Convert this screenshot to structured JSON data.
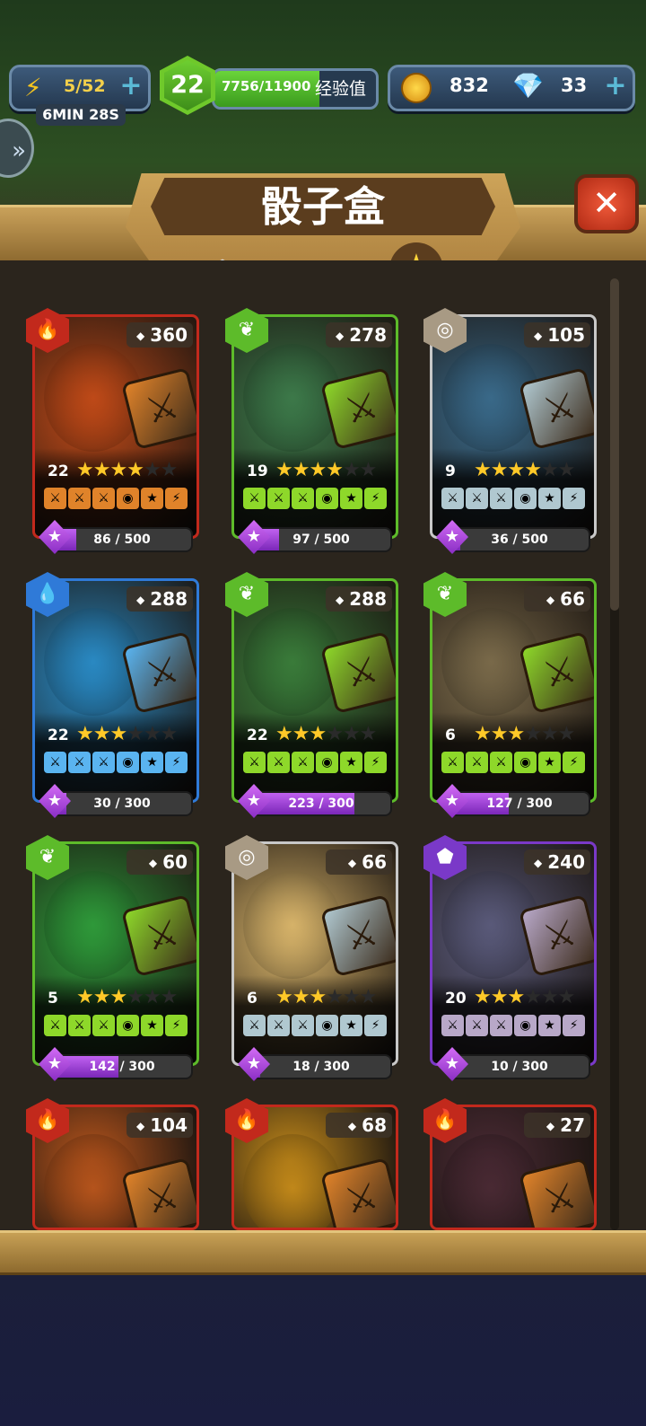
{
  "header": {
    "energy": "5/52",
    "energy_timer": "6MIN 28S",
    "level": "22",
    "xp_text": "7756/11900",
    "xp_label": "经验值",
    "xp_fraction": 0.652,
    "gold": "832",
    "gems": "33"
  },
  "title": "骰子盒",
  "tabs": [
    "hex-cluster",
    "diamond",
    "star"
  ],
  "active_tab": "star",
  "cards": [
    {
      "count": "360",
      "element": "fire",
      "level": "22",
      "stars": 4,
      "progress": "86 / 500",
      "fraction": 0.172,
      "border": "#c2291c",
      "bg": "#c04a18"
    },
    {
      "count": "278",
      "element": "nature",
      "level": "19",
      "stars": 4,
      "progress": "97 / 500",
      "fraction": 0.194,
      "border": "#5dbb2a",
      "bg": "#3d7a4a"
    },
    {
      "count": "105",
      "element": "neutral",
      "level": "9",
      "stars": 4,
      "progress": "36 / 500",
      "fraction": 0.072,
      "border": "#c8c8c8",
      "bg": "#3a6a8a"
    },
    {
      "count": "288",
      "element": "water",
      "level": "22",
      "stars": 3,
      "progress": "30 / 300",
      "fraction": 0.1,
      "border": "#2f7ad8",
      "bg": "#2a8ac4"
    },
    {
      "count": "288",
      "element": "nature",
      "level": "22",
      "stars": 3,
      "progress": "223 / 300",
      "fraction": 0.743,
      "border": "#5dbb2a",
      "bg": "#3a7c3a"
    },
    {
      "count": "66",
      "element": "nature",
      "level": "6",
      "stars": 3,
      "progress": "127 / 300",
      "fraction": 0.423,
      "border": "#5dbb2a",
      "bg": "#7a6a4a"
    },
    {
      "count": "60",
      "element": "nature",
      "level": "5",
      "stars": 3,
      "progress": "142 / 300",
      "fraction": 0.473,
      "border": "#5dbb2a",
      "bg": "#2f9a3a"
    },
    {
      "count": "66",
      "element": "neutral",
      "level": "6",
      "stars": 3,
      "progress": "18 / 300",
      "fraction": 0.06,
      "border": "#c8c8c8",
      "bg": "#d8b46a"
    },
    {
      "count": "240",
      "element": "magic",
      "level": "20",
      "stars": 3,
      "progress": "10 / 300",
      "fraction": 0.033,
      "border": "#7a39c8",
      "bg": "#5a5a7a"
    },
    {
      "count": "104",
      "element": "fire",
      "level": "",
      "stars": 0,
      "progress": "",
      "fraction": 0,
      "border": "#c2291c",
      "bg": "#b8551c"
    },
    {
      "count": "68",
      "element": "fire",
      "level": "",
      "stars": 0,
      "progress": "",
      "fraction": 0,
      "border": "#c2291c",
      "bg": "#c48a1a"
    },
    {
      "count": "27",
      "element": "fire",
      "level": "",
      "stars": 0,
      "progress": "",
      "fraction": 0,
      "border": "#c2291c",
      "bg": "#4a2a34"
    }
  ],
  "colors": {
    "fire": "#c2291c",
    "nature": "#5dbb2a",
    "neutral": "#a89a84",
    "water": "#2f7ad8",
    "magic": "#7a39c8"
  }
}
